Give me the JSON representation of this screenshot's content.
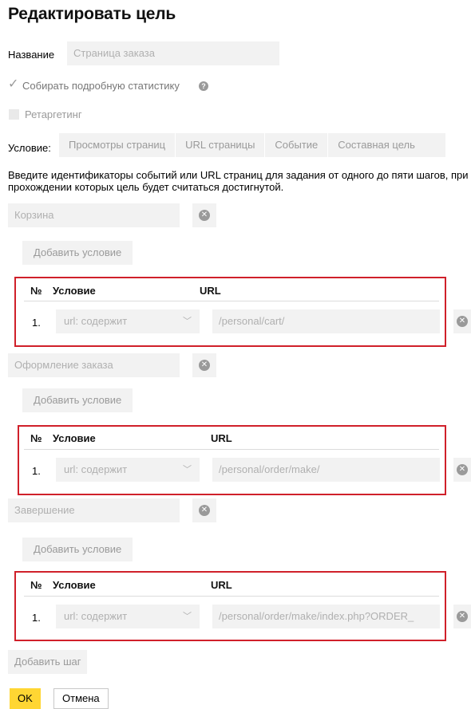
{
  "page": {
    "title": "Редактировать цель"
  },
  "name_field": {
    "label": "Название",
    "placeholder": "Страница заказа"
  },
  "detailed_stats": {
    "label": "Собирать подробную статистику",
    "checked": true,
    "help_icon": "question-circle-icon"
  },
  "retargeting": {
    "label": "Ретаргетинг",
    "checked": false
  },
  "condition": {
    "label": "Условие:",
    "tabs": [
      "Просмотры страниц",
      "URL страницы",
      "Событие",
      "Составная цель"
    ]
  },
  "description": "Введите идентификаторы событий или URL страниц для задания от одного до пяти шагов, при прохождении которых цель будет считаться достигнутой.",
  "table_headers": {
    "num": "№",
    "condition": "Условие",
    "url": "URL"
  },
  "steps": [
    {
      "name": "Корзина",
      "add_condition": "Добавить условие",
      "row": {
        "num": "1.",
        "condition": "url: содержит",
        "url": "/personal/cart/"
      }
    },
    {
      "name": "Оформление заказа",
      "add_condition": "Добавить условие",
      "row": {
        "num": "1.",
        "condition": "url: содержит",
        "url": "/personal/order/make/"
      }
    },
    {
      "name": "Завершение",
      "add_condition": "Добавить условие",
      "row": {
        "num": "1.",
        "condition": "url: содержит",
        "url": "/personal/order/make/index.php?ORDER_"
      }
    }
  ],
  "add_step": "Добавить шаг",
  "ok": "OK",
  "cancel": "Отмена",
  "colors": {
    "highlight_frame": "#d0202a",
    "ok_button": "#ffd633",
    "field_bg": "#f2f2f2"
  }
}
